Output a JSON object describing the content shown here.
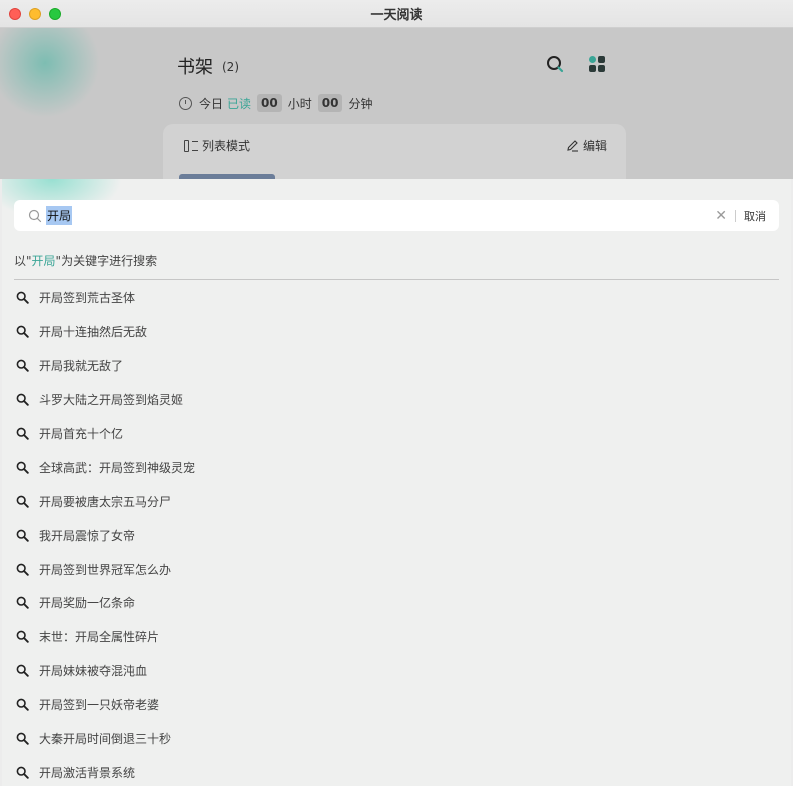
{
  "window": {
    "title": "一天阅读"
  },
  "shelf": {
    "title": "书架",
    "count": "(2)",
    "today_label": "今日",
    "today_read": "已读",
    "hours": "00",
    "hours_unit": "小时",
    "minutes": "00",
    "minutes_unit": "分钟",
    "list_mode": "列表模式",
    "edit": "编辑"
  },
  "search": {
    "query": "开局",
    "cancel": "取消",
    "hint_prefix": "以\"",
    "hint_keyword": "开局",
    "hint_suffix": "\"为关键字进行搜索"
  },
  "results": [
    "开局签到荒古圣体",
    "开局十连抽然后无敌",
    "开局我就无敌了",
    "斗罗大陆之开局签到焰灵姬",
    "开局首充十个亿",
    "全球高武：开局签到神级灵宠",
    "开局要被唐太宗五马分尸",
    "我开局震惊了女帝",
    "开局签到世界冠军怎么办",
    "开局奖励一亿条命",
    "末世：开局全属性碎片",
    "开局妹妹被夺混沌血",
    "开局签到一只妖帝老婆",
    "大秦开局时间倒退三十秒",
    "开局激活背景系统"
  ],
  "colors": {
    "accent": "#3aa596"
  }
}
